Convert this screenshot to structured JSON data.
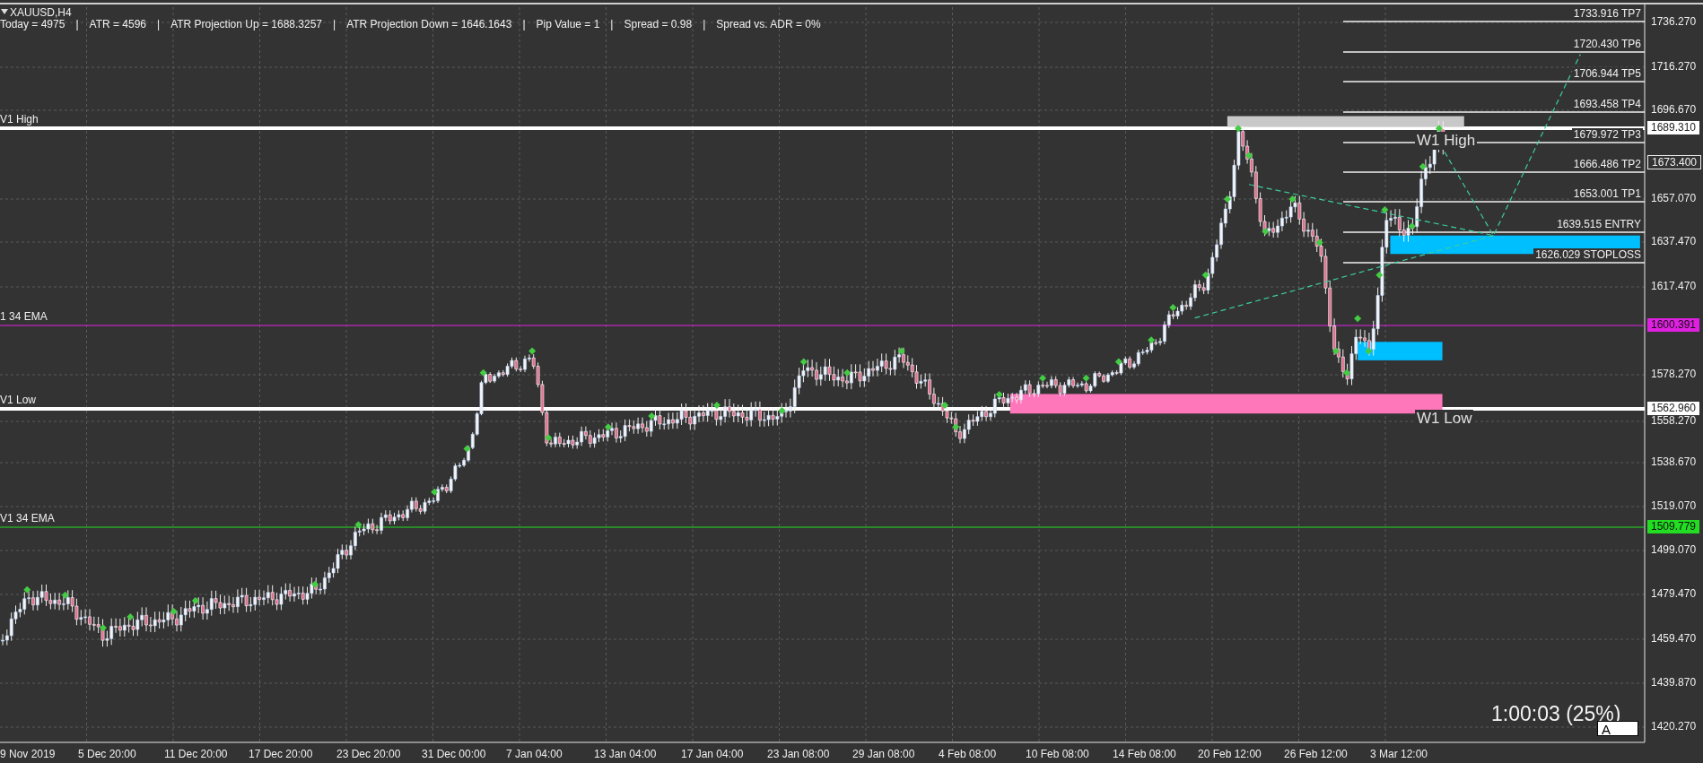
{
  "chart": {
    "symbol": "XAUUSD,H4",
    "info": {
      "separator": "|",
      "items": [
        "Today = 4975",
        "ATR = 4596",
        "ATR Projection Up = 1688.3257",
        "ATR Projection Down = 1646.1643",
        "Pip Value = 1",
        "Spread = 0.98",
        "Spread vs. ADR = 0%"
      ]
    },
    "levels": [
      {
        "label": "V1 High",
        "tag": "1689.310",
        "color": "#ffffff",
        "kind": "weekly"
      },
      {
        "label": "1 34 EMA",
        "tag": "1600.391",
        "color": "#e020e0",
        "kind": "ema"
      },
      {
        "label": "V1 Low",
        "tag": "1562.960",
        "color": "#ffffff",
        "kind": "weekly"
      },
      {
        "label": "V1 34 EMA",
        "tag": "1509.779",
        "color": "#22dd22",
        "kind": "ema"
      }
    ],
    "zone_labels": [
      "W1 High",
      "W1 Low"
    ],
    "targets": [
      "1733.916 TP7",
      "1720.430 TP6",
      "1706.944 TP5",
      "1693.458 TP4",
      "1679.972 TP3",
      "1666.486 TP2",
      "1653.001 TP1",
      "1639.515 ENTRY",
      "1626.029 STOPLOSS"
    ],
    "price_tag": "1673.400",
    "price_axis": [
      "1736.270",
      "1716.270",
      "1696.670",
      "1657.070",
      "1637.470",
      "1617.470",
      "1578.270",
      "1558.270",
      "1538.670",
      "1519.070",
      "1499.070",
      "1479.470",
      "1459.470",
      "1439.870",
      "1420.270"
    ],
    "time_axis": [
      "9 Nov 2019",
      "5 Dec 20:00",
      "11 Dec 20:00",
      "17 Dec 20:00",
      "23 Dec 20:00",
      "31 Dec 00:00",
      "7 Jan 04:00",
      "13 Jan 04:00",
      "17 Jan 04:00",
      "23 Jan 08:00",
      "29 Jan 08:00",
      "4 Feb 08:00",
      "10 Feb 08:00",
      "14 Feb 08:00",
      "20 Feb 12:00",
      "26 Feb 12:00",
      "3 Mar 12:00"
    ],
    "timer": "1:00:03 (25%)",
    "box_label": "A"
  }
}
